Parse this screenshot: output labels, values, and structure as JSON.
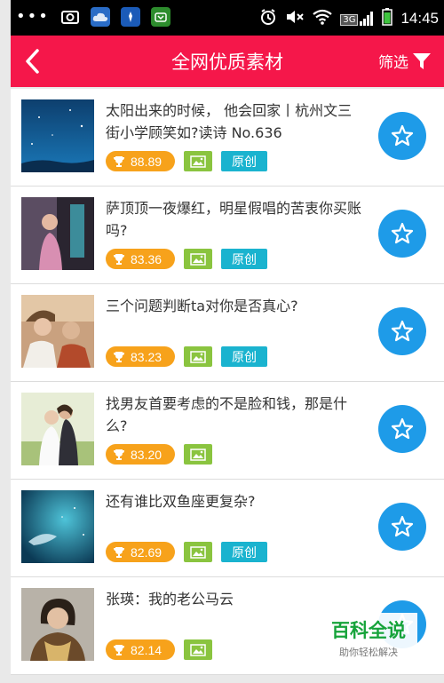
{
  "status_bar": {
    "time": "14:45",
    "network": "3G",
    "icons": [
      "more-icon",
      "screenshot-icon",
      "weather-icon",
      "app-icon",
      "app2-icon",
      "alarm-icon",
      "mute-icon",
      "wifi-icon",
      "signal-icon",
      "battery-icon"
    ]
  },
  "header": {
    "title": "全网优质素材",
    "filter_label": "筛选",
    "background": "#f5174a"
  },
  "items": [
    {
      "title": "太阳出来的时候， 他会回家丨杭州文三街小学顾笑如?读诗 No.636",
      "score": "88.89",
      "has_image": true,
      "original": "原创"
    },
    {
      "title": "萨顶顶一夜爆红，明星假唱的苦衷你买账吗?",
      "score": "83.36",
      "has_image": true,
      "original": "原创"
    },
    {
      "title": "三个问题判断ta对你是否真心?",
      "score": "83.23",
      "has_image": true,
      "original": "原创"
    },
    {
      "title": "找男友首要考虑的不是脸和钱，那是什么?",
      "score": "83.20",
      "has_image": true,
      "original": ""
    },
    {
      "title": "还有谁比双鱼座更复杂?",
      "score": "82.69",
      "has_image": true,
      "original": "原创"
    },
    {
      "title": "张瑛：我的老公马云",
      "score": "82.14",
      "has_image": true,
      "original": ""
    }
  ],
  "watermark": {
    "title": "百科全说",
    "subtitle": "助你轻松解决"
  },
  "colors": {
    "score": "#f7a21b",
    "image_tag": "#8ac43f",
    "original_tag": "#1ab3cf",
    "favorite": "#1e9be8"
  }
}
